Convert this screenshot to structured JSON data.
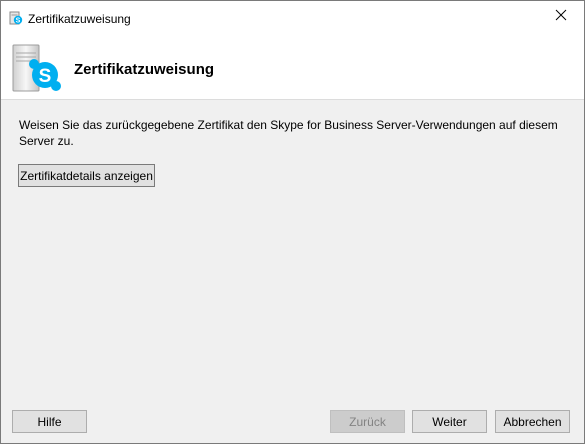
{
  "window": {
    "title": "Zertifikatzuweisung",
    "close_glyph": "✕"
  },
  "header": {
    "title": "Zertifikatzuweisung",
    "graphic": "skype-server-icon"
  },
  "main": {
    "description": "Weisen Sie das zurückgegebene Zertifikat den Skype for Business Server-Verwendungen auf diesem Server zu.",
    "details_button": "Zertifikatdetails anzeigen"
  },
  "footer": {
    "help_button": "Hilfe",
    "back_button": "Zurück",
    "next_button": "Weiter",
    "cancel_button": "Abbrechen"
  },
  "colors": {
    "skype_blue": "#00aff0",
    "dialog_background": "#f0f0f0",
    "button_face": "#e1e1e1",
    "disabled_text": "#838383"
  }
}
